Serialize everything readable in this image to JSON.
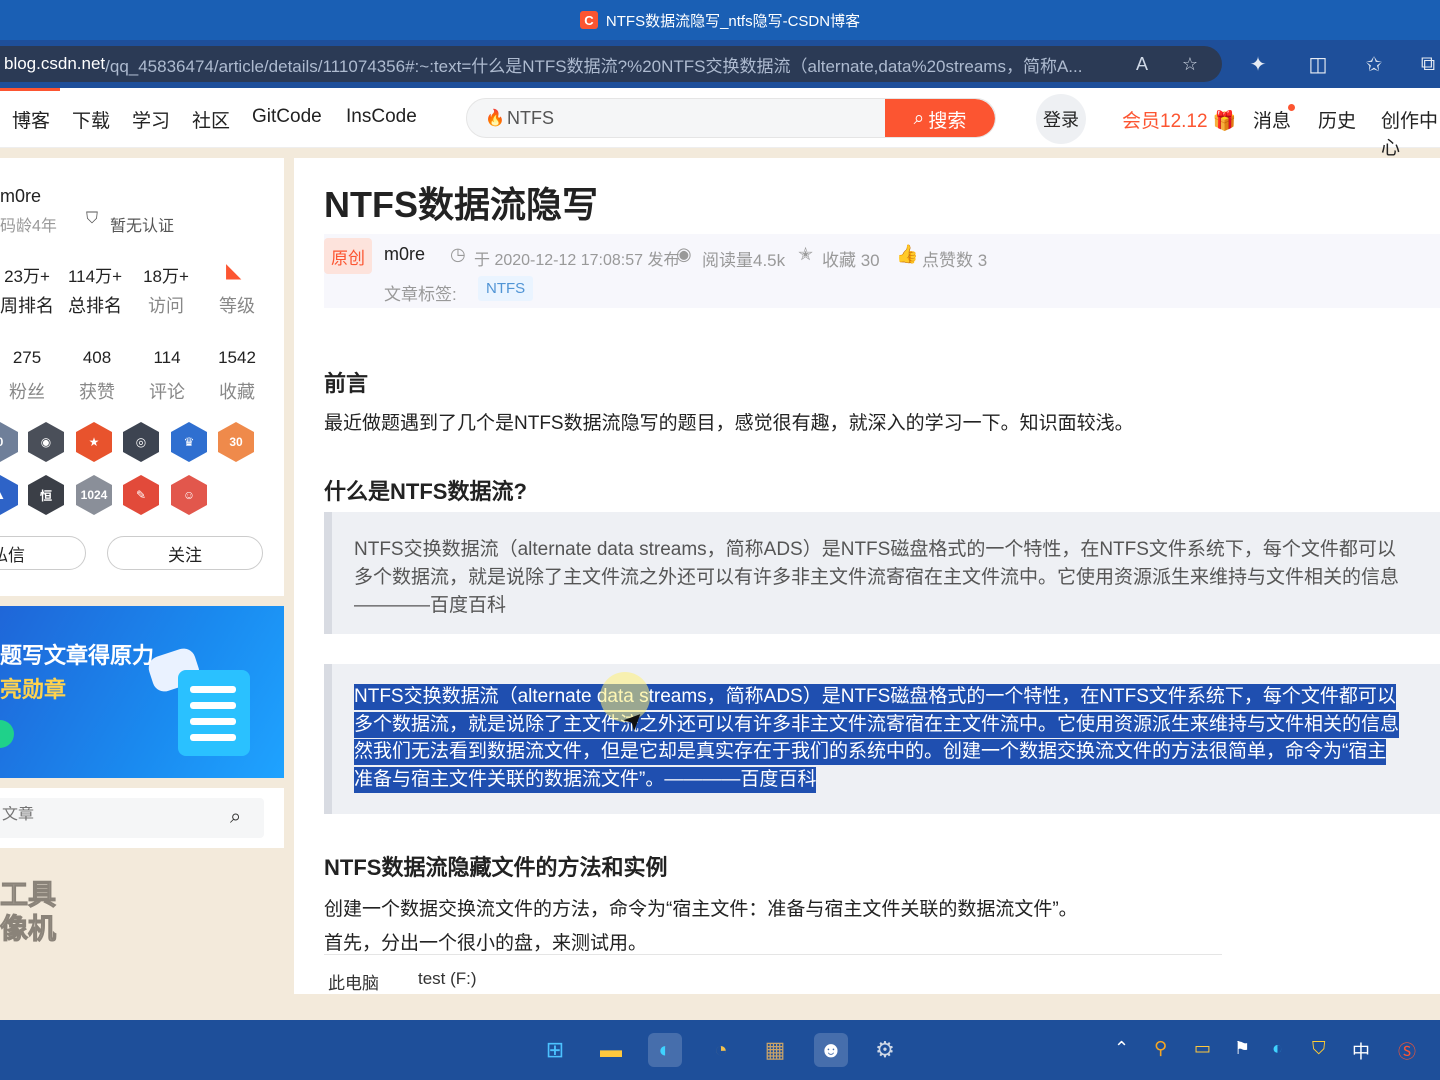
{
  "window": {
    "title": "NTFS数据流隐写_ntfs隐写-CSDN博客",
    "favicon": "C"
  },
  "address": {
    "host": "blog.csdn.net",
    "path": "/qq_45836474/article/details/111074356#:~:text=什么是NTFS数据流?%20NTFS交换数据流（alternate,data%20streams，简称A..."
  },
  "nav": {
    "items": [
      "博客",
      "下载",
      "学习",
      "社区",
      "GitCode",
      "InsCode"
    ],
    "search_value": "NTFS",
    "search_button": "搜索",
    "login": "登录",
    "vip": "会员12.12",
    "messages": "消息",
    "history": "历史",
    "create": "创作中心"
  },
  "profile": {
    "name": "m0re",
    "age": "码龄4年",
    "verify": "暂无认证",
    "stats_row1": [
      {
        "value": "23万+",
        "label": "周排名"
      },
      {
        "value": "114万+",
        "label": "总排名"
      },
      {
        "value": "18万+",
        "label": "访问"
      },
      {
        "value": "",
        "label": "等级"
      }
    ],
    "stats_row2": [
      {
        "value": "275",
        "label": "粉丝"
      },
      {
        "value": "408",
        "label": "获赞"
      },
      {
        "value": "114",
        "label": "评论"
      },
      {
        "value": "1542",
        "label": "收藏"
      }
    ],
    "badge_row1_last": "30",
    "badge_row2_text": "1024",
    "btn_message": "私信",
    "btn_follow": "关注"
  },
  "banner": {
    "line1": "题写文章得原力",
    "line2": "亮勋章"
  },
  "side_search": {
    "placeholder": "文章"
  },
  "side_tool": {
    "line1": "工具",
    "line2": "像机"
  },
  "article": {
    "title": "NTFS数据流隐写",
    "original": "原创",
    "author": "m0re",
    "published": "于 2020-12-12 17:08:57 发布",
    "reads": "阅读量4.5k",
    "favorites": "收藏 30",
    "likes": "点赞数 3",
    "tag_label": "文章标签:",
    "tag": "NTFS",
    "h_intro": "前言",
    "p_intro": "最近做题遇到了几个是NTFS数据流隐写的题目，感觉很有趣，就深入的学习一下。知识面较浅。",
    "h_what": "什么是NTFS数据流?",
    "quote1": [
      "NTFS交换数据流（alternate data streams，简称ADS）是NTFS磁盘格式的一个特性，在NTFS文件系统下，每个文件都可以",
      "多个数据流，就是说除了主文件流之外还可以有许多非主文件流寄宿在主文件流中。它使用资源派生来维持与文件相关的信息",
      "————百度百科"
    ],
    "quote2": [
      "NTFS交换数据流（alternate data streams，简称ADS）是NTFS磁盘格式的一个特性，在NTFS文件系统下，每个文件都可以",
      "多个数据流，就是说除了主文件流之外还可以有许多非主文件流寄宿在主文件流中。它使用资源派生来维持与文件相关的信息",
      "然我们无法看到数据流文件，但是它却是真实存在于我们的系统中的。创建一个数据交换流文件的方法很简单，命令为“宿主",
      "准备与宿主文件关联的数据流文件”。————百度百科"
    ],
    "h_method": "NTFS数据流隐藏文件的方法和实例",
    "p_method1": "创建一个数据交换流文件的方法，命令为“宿主文件：准备与宿主文件关联的数据流文件”。",
    "p_method2": "首先，分出一个很小的盘，来测试用。",
    "explorer_a": "此电脑",
    "explorer_b": "test (F:)"
  },
  "tray": {
    "ime": "中"
  },
  "colors": {
    "brand": "#fc5531",
    "selection": "#1f4fb0",
    "chrome": "#1e4f9a"
  }
}
